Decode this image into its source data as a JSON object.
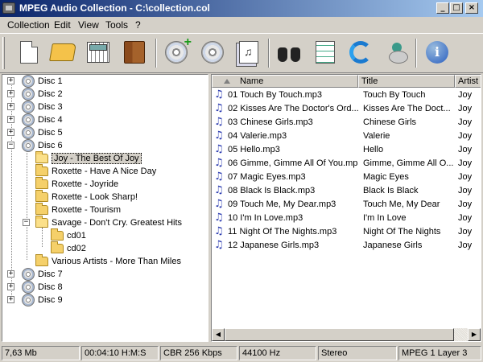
{
  "window": {
    "title": "MPEG Audio Collection - C:\\collection.col"
  },
  "menu": [
    "Collection",
    "Edit",
    "View",
    "Tools",
    "?"
  ],
  "toolbar": {
    "buttons": [
      "new-document",
      "open-folder",
      "calculator",
      "library",
      "add-disc",
      "disc",
      "tracklist",
      "find",
      "report",
      "refresh",
      "tools",
      "info"
    ]
  },
  "tree": {
    "discs_top": [
      "Disc 1",
      "Disc 2",
      "Disc 3",
      "Disc 4",
      "Disc 5",
      "Disc 6"
    ],
    "disc6_folders": [
      "Joy - The Best Of Joy",
      "Roxette - Have A Nice Day",
      "Roxette - Joyride",
      "Roxette - Look Sharp!",
      "Roxette - Tourism",
      "Savage - Don't Cry. Greatest Hits"
    ],
    "savage_sub": [
      "cd01",
      "cd02"
    ],
    "last_folder": "Various Artists - More Than Miles",
    "discs_bottom": [
      "Disc 7",
      "Disc 8",
      "Disc 9"
    ]
  },
  "list": {
    "columns": [
      "Name",
      "Title",
      "Artist"
    ],
    "rows": [
      {
        "name": "01 Touch By Touch.mp3",
        "title": "Touch By Touch",
        "artist": "Joy"
      },
      {
        "name": "02 Kisses Are The Doctor's Ord...",
        "title": "Kisses Are The Doct...",
        "artist": "Joy"
      },
      {
        "name": "03 Chinese Girls.mp3",
        "title": "Chinese Girls",
        "artist": "Joy"
      },
      {
        "name": "04 Valerie.mp3",
        "title": "Valerie",
        "artist": "Joy"
      },
      {
        "name": "05 Hello.mp3",
        "title": "Hello",
        "artist": "Joy"
      },
      {
        "name": "06 Gimme, Gimme All Of You.mp3",
        "title": "Gimme, Gimme All O...",
        "artist": "Joy"
      },
      {
        "name": "07 Magic Eyes.mp3",
        "title": "Magic Eyes",
        "artist": "Joy"
      },
      {
        "name": "08 Black Is Black.mp3",
        "title": "Black Is Black",
        "artist": "Joy"
      },
      {
        "name": "09 Touch Me, My Dear.mp3",
        "title": "Touch Me, My Dear",
        "artist": "Joy"
      },
      {
        "name": "10 I'm In Love.mp3",
        "title": "I'm In Love",
        "artist": "Joy"
      },
      {
        "name": "11 Night Of The Nights.mp3",
        "title": "Night Of The Nights",
        "artist": "Joy"
      },
      {
        "name": "12 Japanese Girls.mp3",
        "title": "Japanese Girls",
        "artist": "Joy"
      }
    ]
  },
  "status": {
    "size": "7,63 Mb",
    "duration": "00:04:10 H:M:S",
    "bitrate": "CBR 256 Kbps",
    "frequency": "44100 Hz",
    "mode": "Stereo",
    "format": "MPEG 1 Layer 3"
  }
}
